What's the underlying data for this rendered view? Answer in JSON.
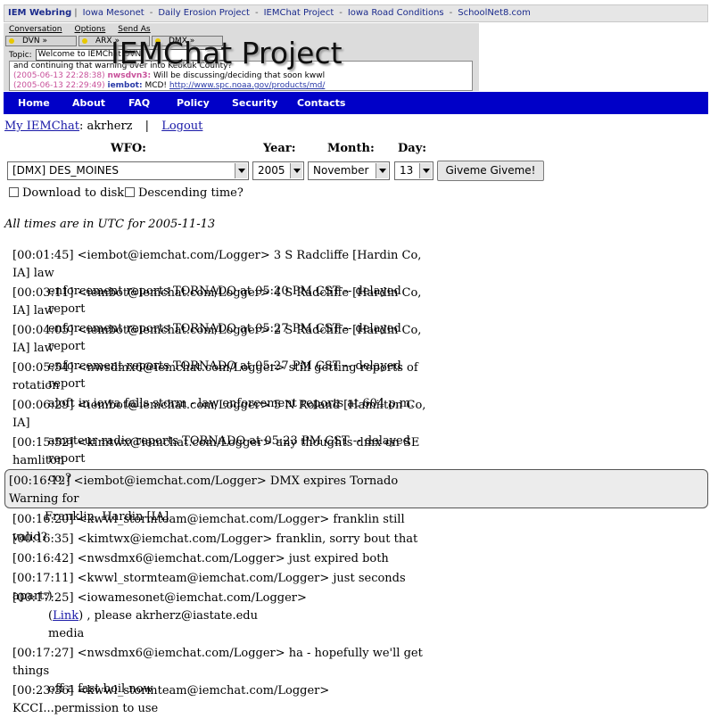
{
  "webring": {
    "title": "IEM Webring",
    "links": [
      "Iowa Mesonet",
      "Daily Erosion Project",
      "IEMChat Project",
      "Iowa Road Conditions",
      "SchoolNet8.com"
    ]
  },
  "banner": {
    "title": "IEMChat Project",
    "menu": [
      "Conversation",
      "Options",
      "Send As"
    ],
    "tabs": [
      "DVN",
      "ARX",
      "DMX"
    ],
    "topic_label": "Topic:",
    "topic_value": "Welcome to IEMChat DVN",
    "chat_line1": "and continuing that warning over into Keokuk County?",
    "chat_line2_ts": "(2005-06-13 22:28:38)",
    "chat_line2_nick": "nwsdvn3:",
    "chat_line2_text": "Will be discussing/deciding that soon kwwl",
    "chat_line3_ts": "(2005-06-13 22:29:49)",
    "chat_line3_nick": "iembot:",
    "chat_line3_text": "MCD!",
    "chat_line3_link": "http://www.spc.noaa.gov/products/md/"
  },
  "nav": {
    "items": [
      "Home",
      "About",
      "FAQ",
      "Policy",
      "Security",
      "Contacts"
    ]
  },
  "user": {
    "my_link": "My IEMChat",
    "name": ": akrherz",
    "sep": "|",
    "logout": "Logout"
  },
  "form": {
    "wfo_label": "WFO:",
    "year_label": "Year:",
    "month_label": "Month:",
    "day_label": "Day:",
    "wfo_value": "[DMX] DES_MOINES",
    "year_value": "2005",
    "month_value": "November",
    "day_value": "13",
    "submit": "Giveme Giveme!",
    "download_label": "Download to disk?",
    "descending_label": "Descending time?"
  },
  "tz_note": "All times are in UTC for 2005-11-13",
  "log": [
    {
      "l1": "[00:01:45] <iembot@iemchat.com/Logger> 3 S Radcliffe [Hardin Co, IA] law",
      "l2": "enforcement reports TORNADO at 05:20 PM CST -- delayed report"
    },
    {
      "l1": "[00:03:11] <iembot@iemchat.com/Logger> 4 S Radcliffe [Hardin Co, IA] law",
      "l2": "enforcement reports TORNADO at 05:27 PM CST -- delayed report"
    },
    {
      "l1": "[00:04:05] <iembot@iemchat.com/Logger> 2 S Radcliffe [Hardin Co, IA] law",
      "l2": "enforcement reports TORNADO at 05:27 PM CST -- delayed report"
    },
    {
      "l1": "[00:05:54] <nwsdmx6@iemchat.com/Logger> still getting reports of rotation",
      "l2": "aloft in iowa falls storm - law enforcement reports at 604 p.m."
    },
    {
      "l1": "[00:06:29] <iembot@iemchat.com/Logger> 5 N Roland [Hamilton Co, IA]",
      "l2": "amateur radio reports TORNADO at 05:23 PM CST -- delayed report"
    },
    {
      "l1": "[00:15:52] <kimtwx@iemchat.com/Logger> any thoughts dmx on SE hamliton",
      "l2": "co.?"
    },
    {
      "l1": "[00:16:12] <iembot@iemchat.com/Logger> DMX expires Tornado Warning for",
      "l2": "Franklin, Hardin [IA]"
    },
    {
      "l1": "[00:16:20] <kwwl_stormteam@iemchat.com/Logger> franklin still valid?"
    },
    {
      "l1": "[00:16:35] <kimtwx@iemchat.com/Logger> franklin, sorry bout that"
    },
    {
      "l1": "[00:16:42] <nwsdmx6@iemchat.com/Logger> just expired both"
    },
    {
      "l1": "[00:17:11] <kwwl_stormteam@iemchat.com/Logger> just seconds apart:)"
    },
    {
      "l1": "[00:17:25] <iowamesonet@iemchat.com/Logger>",
      "l2_pre": "(",
      "l2_link": "Link",
      "l2_post": ") , please akrherz@iastate.edu",
      "l3": "media"
    },
    {
      "l1": "[00:17:27] <nwsdmx6@iemchat.com/Logger> ha - hopefully we'll get things",
      "l2": "off a fast boil now"
    },
    {
      "l1": "[00:23:36] <kwwl_stormteam@iemchat.com/Logger> KCCI...permission to use"
    }
  ]
}
